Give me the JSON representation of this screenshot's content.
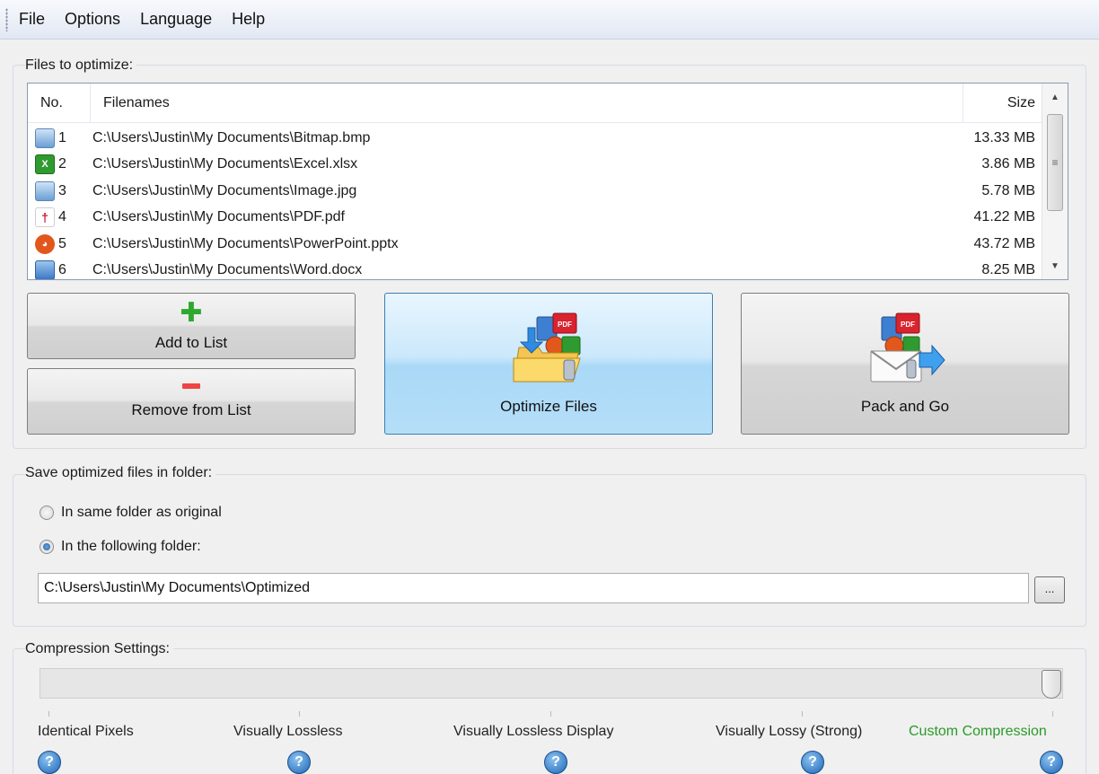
{
  "menu": [
    "File",
    "Options",
    "Language",
    "Help"
  ],
  "files_group": {
    "title": "Files to optimize:",
    "columns": {
      "no": "No.",
      "name": "Filenames",
      "size": "Size"
    },
    "rows": [
      {
        "no": "1",
        "name": "C:\\Users\\Justin\\My Documents\\Bitmap.bmp",
        "size": "13.33 MB",
        "icon": "bitmap-icon"
      },
      {
        "no": "2",
        "name": "C:\\Users\\Justin\\My Documents\\Excel.xlsx",
        "size": "3.86 MB",
        "icon": "excel-icon"
      },
      {
        "no": "3",
        "name": "C:\\Users\\Justin\\My Documents\\Image.jpg",
        "size": "5.78 MB",
        "icon": "image-icon"
      },
      {
        "no": "4",
        "name": "C:\\Users\\Justin\\My Documents\\PDF.pdf",
        "size": "41.22 MB",
        "icon": "pdf-icon"
      },
      {
        "no": "5",
        "name": "C:\\Users\\Justin\\My Documents\\PowerPoint.pptx",
        "size": "43.72 MB",
        "icon": "powerpoint-icon"
      },
      {
        "no": "6",
        "name": "C:\\Users\\Justin\\My Documents\\Word.docx",
        "size": "8.25 MB",
        "icon": "word-icon"
      }
    ],
    "buttons": {
      "add": "Add to List",
      "remove": "Remove from List",
      "optimize": "Optimize Files",
      "pack": "Pack and Go"
    }
  },
  "save_group": {
    "title": "Save optimized files in folder:",
    "option_same": "In same folder as original",
    "option_following": "In the following folder:",
    "selected": "following",
    "folder_path": "C:\\Users\\Justin\\My Documents\\Optimized",
    "browse_label": "..."
  },
  "compression": {
    "title": "Compression Settings:",
    "levels": [
      "Identical Pixels",
      "Visually Lossless",
      "Visually Lossless Display",
      "Visually Lossy (Strong)",
      "Custom Compression"
    ],
    "selected_index": 4,
    "active_color": "#2a9a2a"
  }
}
